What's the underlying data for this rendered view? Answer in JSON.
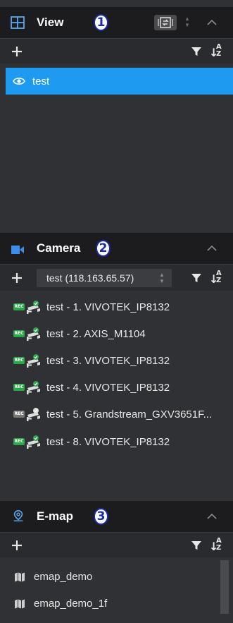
{
  "colors": {
    "header_bg": "#1c1c1e",
    "list_bg": "#303134",
    "toolbar_bg": "#2a2b2e",
    "selected_bg": "#1e9bf0",
    "rec_active": "#2ba84a",
    "rec_inactive": "#777777",
    "camera_accent": "#3c8ee8",
    "badge_text": "#1a2aa8"
  },
  "view_panel": {
    "title": "View",
    "badge": "1",
    "icon": "grid-icon",
    "items": [
      {
        "label": "test",
        "icon": "eye-icon",
        "selected": true
      }
    ]
  },
  "camera_panel": {
    "title": "Camera",
    "badge": "2",
    "icon": "camera-icon",
    "server_select": "test (118.163.65.57)",
    "items": [
      {
        "label": "test - 1. VIVOTEK_IP8132",
        "rec_badge": "REC",
        "online": true
      },
      {
        "label": "test - 2. AXIS_M1104",
        "rec_badge": "REC",
        "online": true
      },
      {
        "label": "test - 3. VIVOTEK_IP8132",
        "rec_badge": "REC",
        "online": true
      },
      {
        "label": "test - 4. VIVOTEK_IP8132",
        "rec_badge": "REC",
        "online": true
      },
      {
        "label": "test - 5. Grandstream_GXV3651F...",
        "rec_badge": "REC",
        "online": false
      },
      {
        "label": "test - 8. VIVOTEK_IP8132",
        "rec_badge": "REC",
        "online": true
      }
    ]
  },
  "emap_panel": {
    "title": "E-map",
    "badge": "3",
    "icon": "map-pin-icon",
    "items": [
      {
        "label": "emap_demo",
        "icon": "map-icon"
      },
      {
        "label": "emap_demo_1f",
        "icon": "map-icon"
      }
    ]
  }
}
